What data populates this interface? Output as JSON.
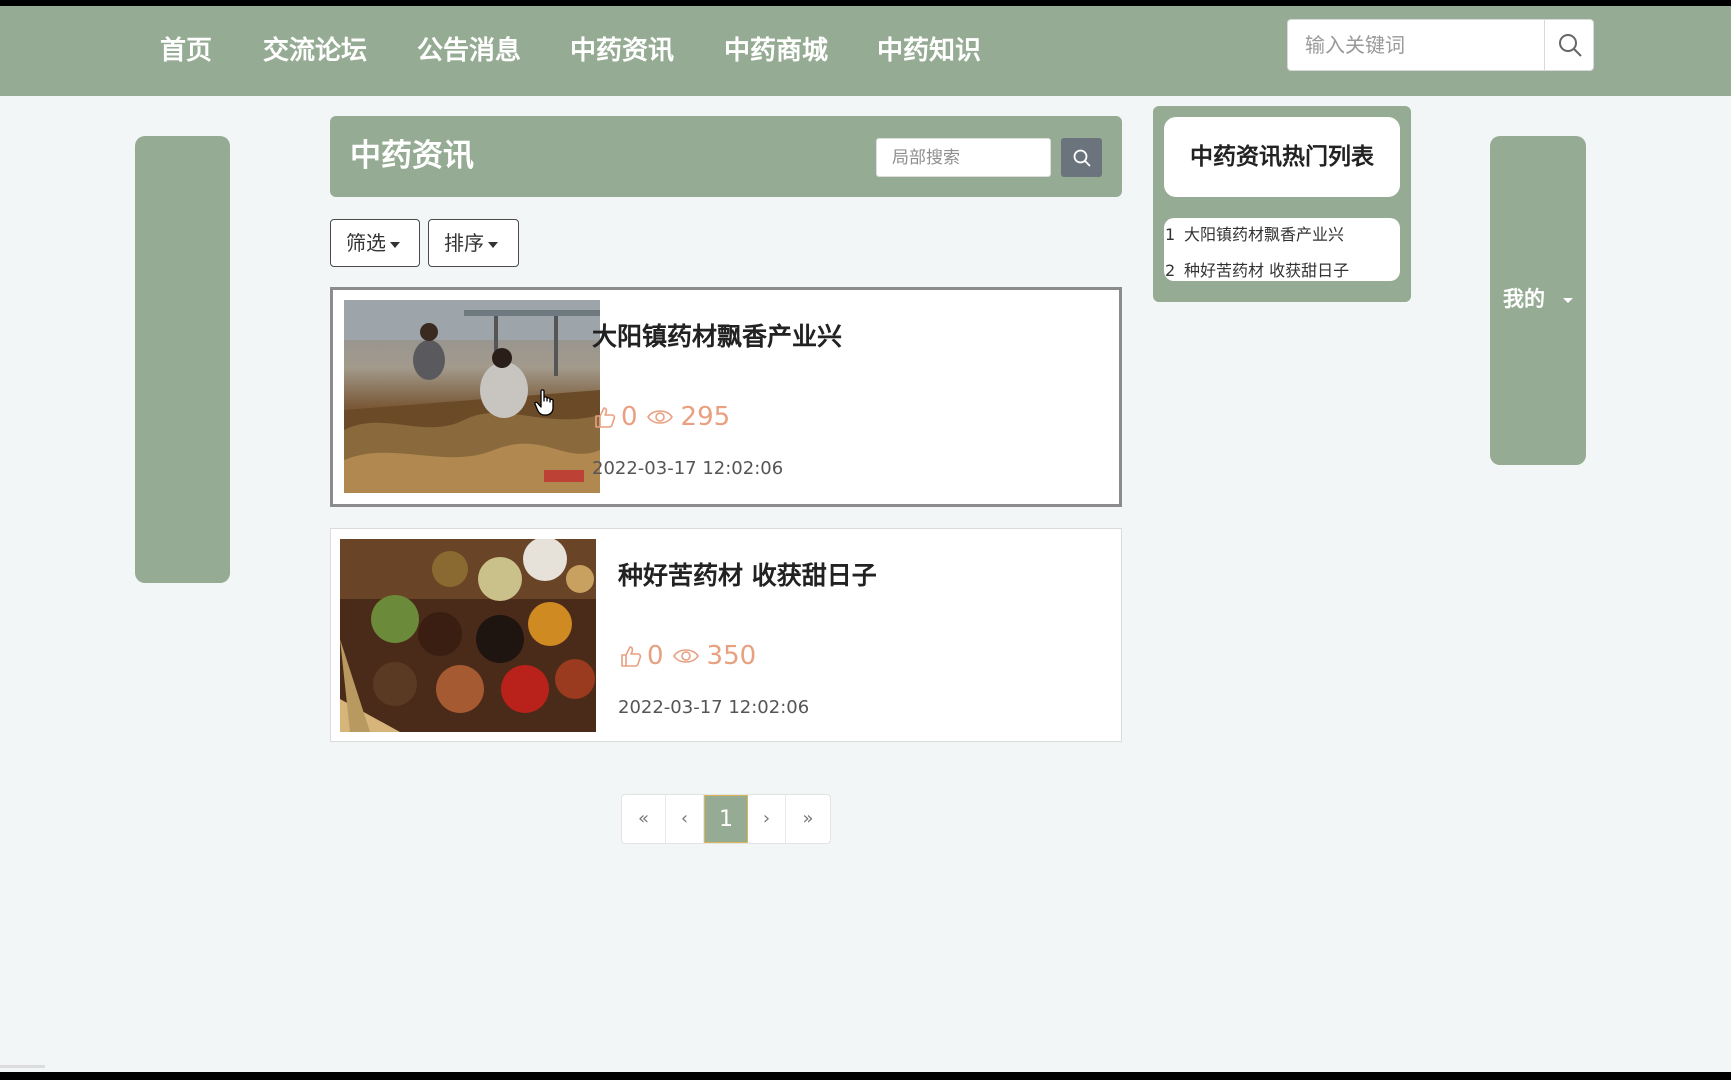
{
  "nav": {
    "items": [
      {
        "label": "首页"
      },
      {
        "label": "交流论坛"
      },
      {
        "label": "公告消息"
      },
      {
        "label": "中药资讯"
      },
      {
        "label": "中药商城"
      },
      {
        "label": "中药知识"
      }
    ],
    "search_placeholder": "输入关键词",
    "search_icon": "search-icon"
  },
  "section": {
    "title": "中药资讯",
    "search_placeholder": "局部搜索",
    "search_icon": "search-icon"
  },
  "filters": {
    "filter_label": "筛选",
    "sort_label": "排序"
  },
  "news": [
    {
      "title": "大阳镇药材飘香产业兴",
      "likes": "0",
      "views": "295",
      "date": "2022-03-17 12:02:06",
      "image": "herb-farmers-photo"
    },
    {
      "title": "种好苦药材 收获甜日子",
      "likes": "0",
      "views": "350",
      "date": "2022-03-17 12:02:06",
      "image": "herbal-spices-photo"
    }
  ],
  "pagination": {
    "first": "«",
    "prev": "‹",
    "current": "1",
    "next": "›",
    "last": "»"
  },
  "hot": {
    "title": "中药资讯热门列表",
    "items": [
      {
        "num": "1",
        "title": "大阳镇药材飘香产业兴"
      },
      {
        "num": "2",
        "title": "种好苦药材 收获甜日子"
      }
    ]
  },
  "user_menu": {
    "label": "我的"
  },
  "colors": {
    "theme": "#96ab93",
    "background": "#f2f6f6",
    "stats": "#e8a080",
    "search_button": "#6b747c"
  }
}
